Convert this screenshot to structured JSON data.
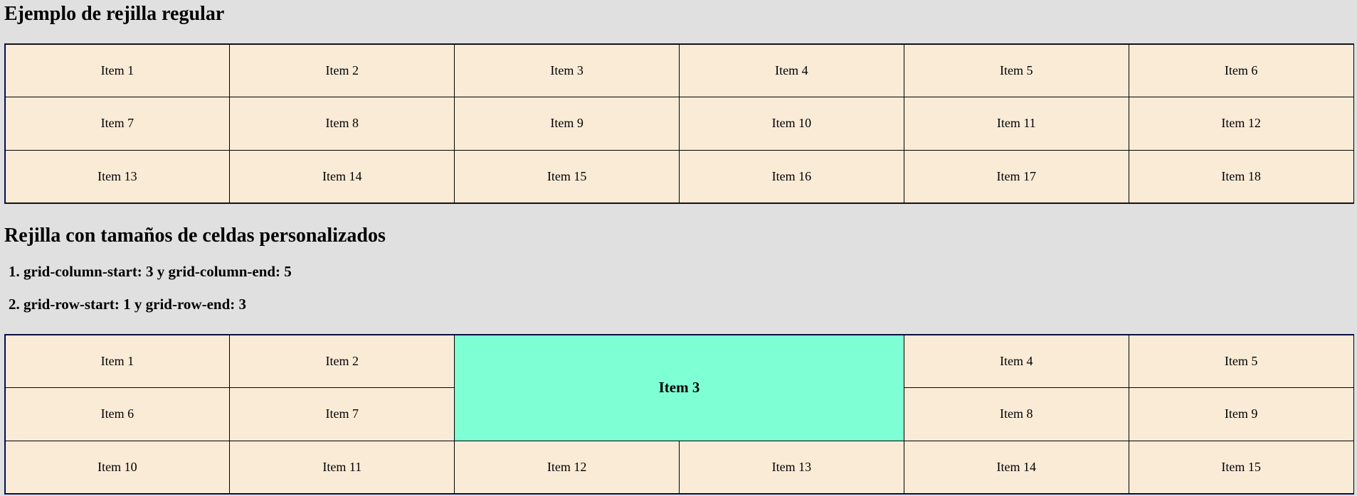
{
  "section_regular": {
    "title": "Ejemplo de rejilla regular",
    "items": [
      "Item 1",
      "Item 2",
      "Item 3",
      "Item 4",
      "Item 5",
      "Item 6",
      "Item 7",
      "Item 8",
      "Item 9",
      "Item 10",
      "Item 11",
      "Item 12",
      "Item 13",
      "Item 14",
      "Item 15",
      "Item 16",
      "Item 17",
      "Item 18"
    ]
  },
  "section_custom": {
    "title": "Rejilla con tamaños de celdas personalizados",
    "rules": [
      "grid-column-start: 3 y grid-column-end: 5",
      "grid-row-start: 1 y grid-row-end: 3"
    ],
    "items": [
      "Item 1",
      "Item 2",
      "Item 3",
      "Item 4",
      "Item 5",
      "Item 6",
      "Item 7",
      "Item 8",
      "Item 9",
      "Item 10",
      "Item 11",
      "Item 12",
      "Item 13",
      "Item 14",
      "Item 15"
    ],
    "highlight_color": "#7fffd4",
    "cell_color": "#faebd7"
  }
}
